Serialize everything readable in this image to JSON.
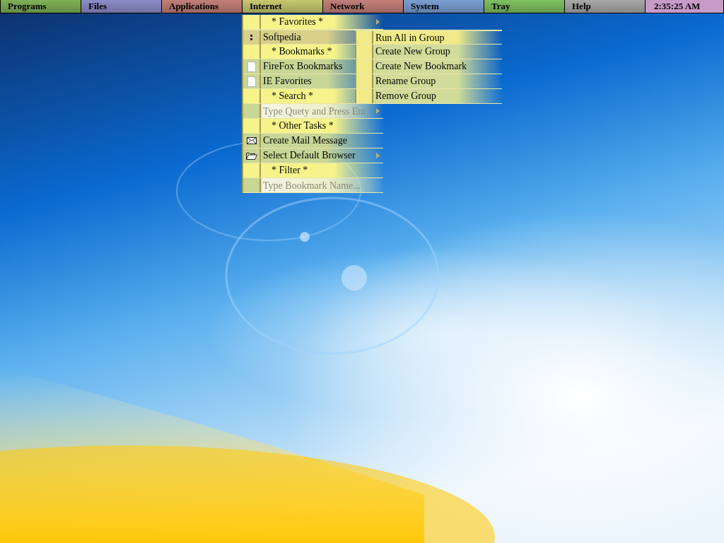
{
  "top_bar": {
    "items": [
      {
        "label": "Programs",
        "color": "#7fb055"
      },
      {
        "label": "Files",
        "color": "#8c8cc8"
      },
      {
        "label": "Applications",
        "color": "#c27f78"
      },
      {
        "label": "Internet",
        "color": "#c8c870"
      },
      {
        "label": "Network",
        "color": "#c27f78"
      },
      {
        "label": "System",
        "color": "#7a9ed2"
      },
      {
        "label": "Tray",
        "color": "#7ec060"
      },
      {
        "label": "Help",
        "color": "#a8a8a8"
      }
    ],
    "clock": "2:35:25 AM"
  },
  "menu": {
    "items": [
      {
        "kind": "header",
        "label": "* Favorites *",
        "submenu": true
      },
      {
        "kind": "link",
        "label": "Softpedia",
        "selected": true
      },
      {
        "kind": "header",
        "label": "* Bookmarks *"
      },
      {
        "kind": "import",
        "label": "FireFox Bookmarks",
        "selected": false
      },
      {
        "kind": "import",
        "label": "IE Favorites",
        "selected": false
      },
      {
        "kind": "header",
        "label": "* Search *"
      },
      {
        "kind": "field",
        "placeholder": "Type Quety and Press Ent",
        "submenu": true
      },
      {
        "kind": "header",
        "label": "* Other Tasks *"
      },
      {
        "kind": "compose",
        "label": "Create Mail Message",
        "selected": false
      },
      {
        "kind": "choose",
        "label": "Select Default Browser",
        "selected": false,
        "submenu": true
      },
      {
        "kind": "header",
        "label": "* Filter *"
      },
      {
        "kind": "field",
        "placeholder": "Type Bookmark Name..."
      }
    ]
  },
  "submenu": {
    "items": [
      {
        "label": "Run All in Group",
        "selected": true
      },
      {
        "label": "Create New Group",
        "selected": false
      },
      {
        "label": "Create New Bookmark",
        "selected": false
      },
      {
        "label": "Rename Group",
        "selected": false
      },
      {
        "label": "Remove Group",
        "selected": false
      }
    ]
  }
}
